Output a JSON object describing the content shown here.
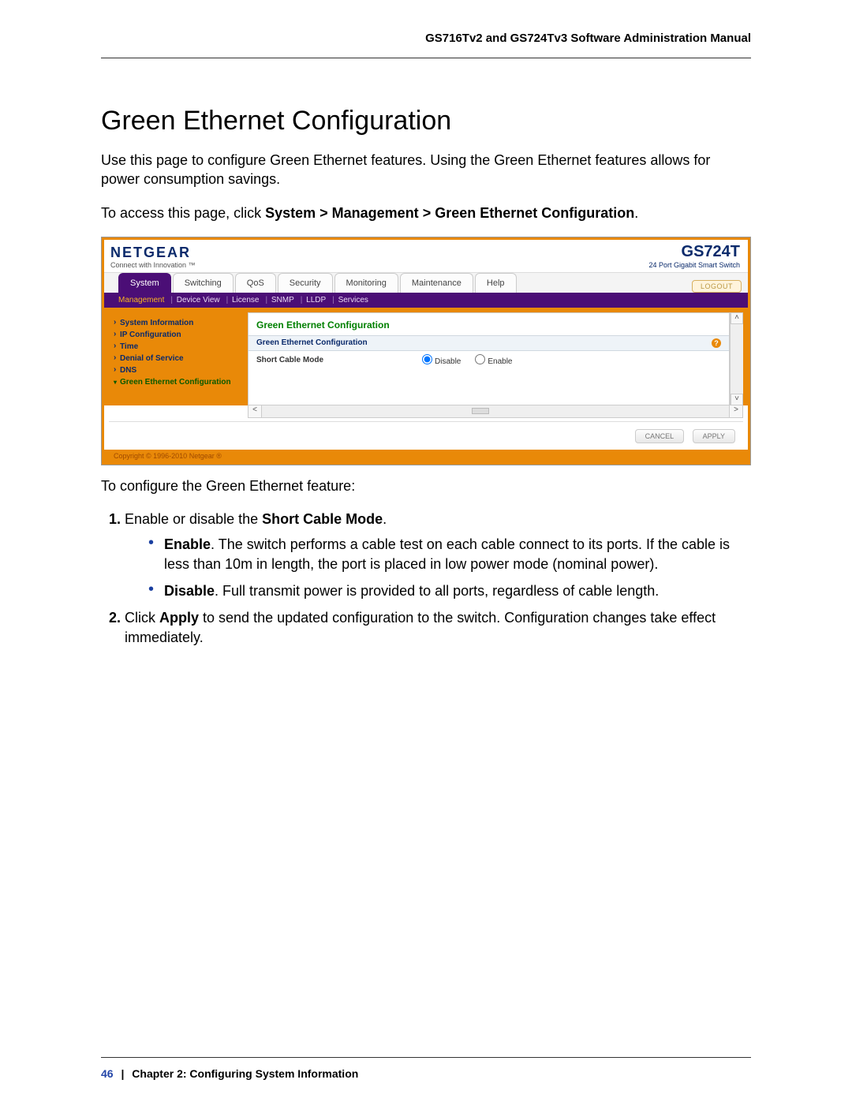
{
  "doc_header": "GS716Tv2 and GS724Tv3 Software Administration Manual",
  "section_title": "Green Ethernet Configuration",
  "intro": "Use this page to configure Green Ethernet features. Using the Green Ethernet features allows for power consumption savings.",
  "access_prefix": "To access this page, click ",
  "access_path_1": "System",
  "access_path_sep": " > ",
  "access_path_2": "Management",
  "access_path_3": "Green Ethernet Configuration",
  "access_suffix": ".",
  "screenshot": {
    "brand": "NETGEAR",
    "brand_tag": "Connect with Innovation ™",
    "model": "GS724T",
    "model_sub": "24 Port Gigabit Smart Switch",
    "tabs": [
      "System",
      "Switching",
      "QoS",
      "Security",
      "Monitoring",
      "Maintenance",
      "Help"
    ],
    "logout": "LOGOUT",
    "subnav": [
      "Management",
      "Device View",
      "License",
      "SNMP",
      "LLDP",
      "Services"
    ],
    "sidebar": [
      "System Information",
      "IP Configuration",
      "Time",
      "Denial of Service",
      "DNS",
      "Green Ethernet Configuration"
    ],
    "panel_title": "Green Ethernet Configuration",
    "panel_head": "Green Ethernet Configuration",
    "row_label": "Short Cable Mode",
    "opt_disable": "Disable",
    "opt_enable": "Enable",
    "btn_cancel": "CANCEL",
    "btn_apply": "APPLY",
    "copyright": "Copyright © 1996-2010 Netgear ®"
  },
  "configure_lead": "To configure the Green Ethernet feature:",
  "step1_prefix": "Enable or disable the ",
  "step1_bold": "Short Cable Mode",
  "step1_suffix": ".",
  "bullet_enable_label": "Enable",
  "bullet_enable_text": ". The switch performs a cable test on each cable connect to its ports. If the cable is less than 10m in length, the port is placed in low power mode (nominal power).",
  "bullet_disable_label": "Disable",
  "bullet_disable_text": ". Full transmit power is provided to all ports, regardless of cable length.",
  "step2_prefix": "Click ",
  "step2_bold": "Apply",
  "step2_suffix": " to send the updated configuration to the switch. Configuration changes take effect immediately.",
  "footer": {
    "page": "46",
    "chapter": "Chapter 2:  Configuring System Information"
  }
}
